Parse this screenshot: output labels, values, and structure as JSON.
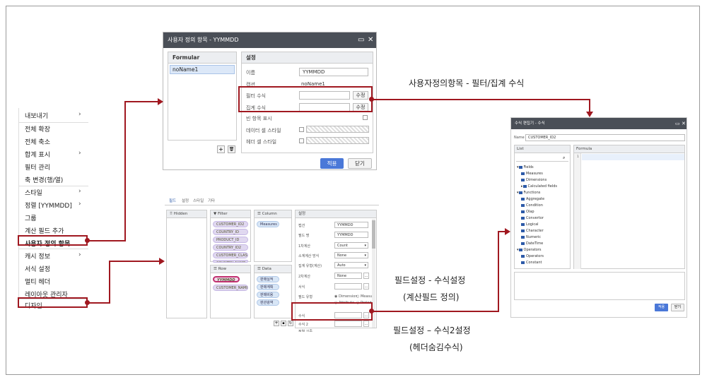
{
  "context_menu": {
    "items": [
      {
        "label": "내보내기",
        "arrow": "›"
      },
      {
        "label": "전체 확장",
        "arrow": ""
      },
      {
        "label": "전체 축소",
        "arrow": ""
      },
      {
        "label": "합계 표시",
        "arrow": "›"
      },
      {
        "label": "필터 관리",
        "arrow": ""
      },
      {
        "label": "축 변경(행/열)",
        "arrow": ""
      },
      {
        "label": "스타일",
        "arrow": "›"
      },
      {
        "label": "정렬 [YYMMDD]",
        "arrow": "›"
      },
      {
        "label": "그룹",
        "arrow": ""
      },
      {
        "label": "계산 필드 추가",
        "arrow": ""
      },
      {
        "label": "사용자 정의 항목",
        "arrow": ""
      },
      {
        "label": "캐시 정보",
        "arrow": "›"
      },
      {
        "label": "서식 설정",
        "arrow": ""
      },
      {
        "label": "멀티 헤더",
        "arrow": ""
      },
      {
        "label": "레이아웃 관리자",
        "arrow": ""
      },
      {
        "label": "디자인",
        "arrow": ""
      }
    ]
  },
  "custom_item_dialog": {
    "title": "사용자 정의 항목 - YYMMDD",
    "formular_header": "Formular",
    "formular_item": "noName1",
    "settings_header": "설정",
    "rows": {
      "name_label": "이름",
      "name_value": "YYMMDD",
      "caption_label": "캡션",
      "caption_value": "noName1",
      "filter_label": "필터 수식",
      "filter_btn": "수정",
      "agg_label": "집계 수식",
      "agg_btn": "수정",
      "empty_label": "빈 항목 표시",
      "data_style_label": "데이터 셀 스타일",
      "header_style_label": "헤더 셀 스타일"
    },
    "add_btn": "+",
    "delete_icon": "trash-icon",
    "apply_btn": "적용",
    "close_btn": "닫기"
  },
  "field_panel": {
    "tabs": [
      "필드",
      "설정",
      "스타일",
      "기타"
    ],
    "hidden_header": "Hidden",
    "filter_header": "Filter",
    "filter_items": [
      "CUSTOMER_ID2",
      "COUNTRY_ID",
      "PRODUCT_ID",
      "COUNTRY_ID2",
      "CUSTOMER_CLASS",
      "COUNTRY_NAME"
    ],
    "column_header": "Column",
    "column_items": [
      "Measures"
    ],
    "row_header": "Row",
    "row_items": [
      "YYMMDD",
      "CUSTOMER_NAME"
    ],
    "data_header": "Data",
    "data_items": [
      "판매실적",
      "판매계획",
      "판매비용",
      "판관광역"
    ],
    "settings_header": "설정",
    "settings_rows": [
      {
        "label": "캡션",
        "value": "YYMMDD"
      },
      {
        "label": "필드 명",
        "value": "YYMMDD"
      },
      {
        "label": "1차계산",
        "value": "Count"
      },
      {
        "label": "소계계산 방식",
        "value": "None"
      },
      {
        "label": "집계 유형(계산)",
        "value": "Auto"
      },
      {
        "label": "2차계산",
        "value": "None"
      },
      {
        "label": "서식",
        "value": ""
      },
      {
        "label": "필드 유형",
        "value": ""
      },
      {
        "label": "수식",
        "value": ""
      },
      {
        "label": "수식 2",
        "value": ""
      },
      {
        "label": "정렬 기준",
        "value": ""
      }
    ],
    "field_type_options": [
      "Dimension",
      "Measure",
      "Attribute",
      "Period"
    ],
    "bottom_icons": [
      "add-icon",
      "trash-icon",
      "refresh-icon"
    ]
  },
  "formula_dialog": {
    "title": "수식 편집기 - 수식",
    "name_label": "Name",
    "name_value": "CUSTOMER_ID2",
    "list_header": "List",
    "formula_header": "Formula",
    "line_number": "1",
    "tree": [
      {
        "label": "Fields",
        "level": 0
      },
      {
        "label": "Measures",
        "level": 1
      },
      {
        "label": "Dimensions",
        "level": 1
      },
      {
        "label": "Calculated fields",
        "level": 1
      },
      {
        "label": "Functions",
        "level": 0
      },
      {
        "label": "Aggregate",
        "level": 1
      },
      {
        "label": "Condition",
        "level": 1
      },
      {
        "label": "Olap",
        "level": 1
      },
      {
        "label": "Convertor",
        "level": 1
      },
      {
        "label": "Logical",
        "level": 1
      },
      {
        "label": "Character",
        "level": 1
      },
      {
        "label": "Numeric",
        "level": 1
      },
      {
        "label": "DateTime",
        "level": 1
      },
      {
        "label": "Operators",
        "level": 0
      },
      {
        "label": "Operators",
        "level": 1
      },
      {
        "label": "Constant",
        "level": 1
      }
    ],
    "apply_btn": "적용",
    "close_btn": "닫기"
  },
  "annotations": {
    "top_right": "사용자정의항목  - 필터/집계 수식",
    "mid_1": "필드설정  - 수식설정",
    "mid_2": "(계산필드 정의)",
    "bot_1": "필드설정 – 수식2설정",
    "bot_2": "(헤더숨김수식)"
  },
  "colors": {
    "accent": "#a01820",
    "titlebar": "#4a4f57",
    "primary_button": "#4a78d8"
  }
}
